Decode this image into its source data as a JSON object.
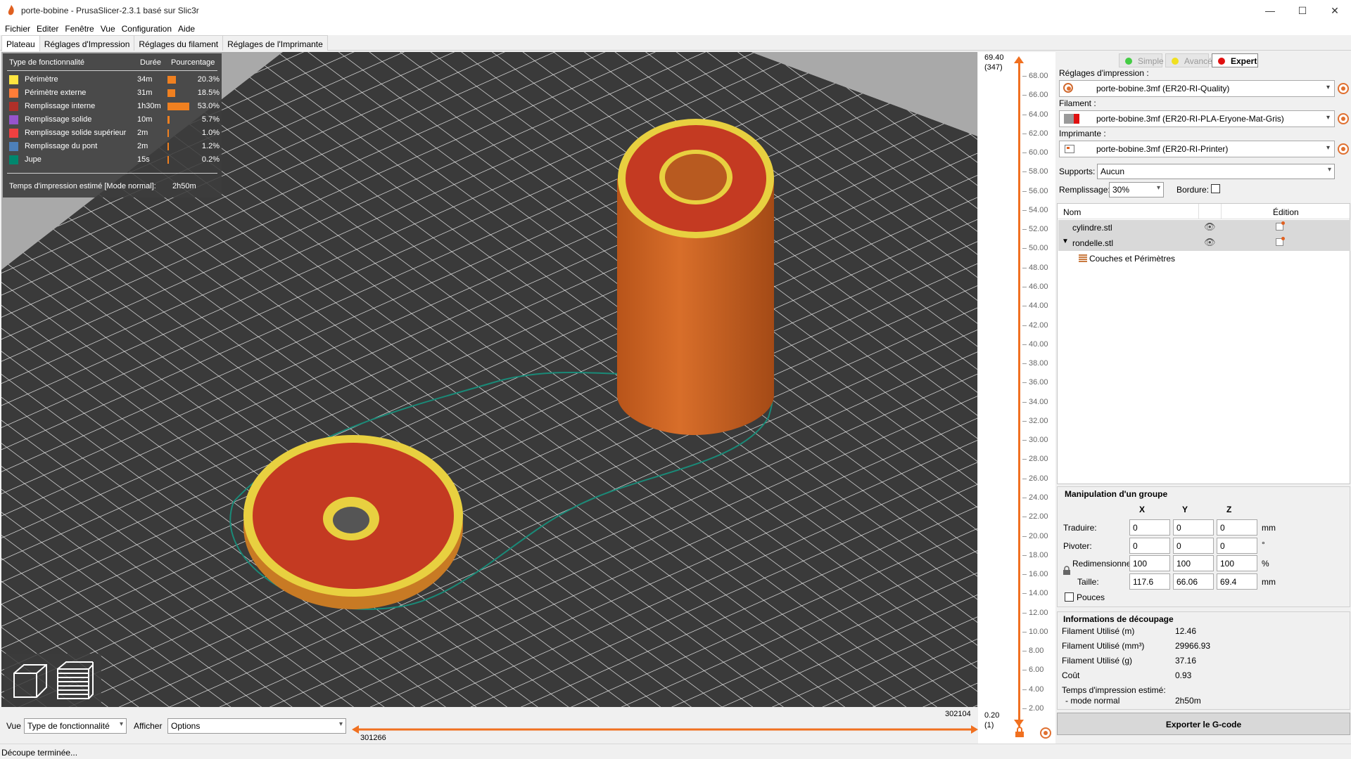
{
  "window": {
    "title": "porte-bobine - PrusaSlicer-2.3.1 basé sur Slic3r",
    "min": "—",
    "max": "☐",
    "close": "✕"
  },
  "menu": [
    "Fichier",
    "Editer",
    "Fenêtre",
    "Vue",
    "Configuration",
    "Aide"
  ],
  "tabs": [
    "Plateau",
    "Réglages d'Impression",
    "Réglages du filament",
    "Réglages de l'Imprimante"
  ],
  "legend": {
    "headers": {
      "type": "Type de fonctionnalité",
      "time": "Durée",
      "pct": "Pourcentage"
    },
    "rows": [
      {
        "name": "Périmètre",
        "time": "34m",
        "pct": "20.3%",
        "value": 20.3,
        "color": "#ffe640"
      },
      {
        "name": "Périmètre externe",
        "time": "31m",
        "pct": "18.5%",
        "value": 18.5,
        "color": "#ff7d38"
      },
      {
        "name": "Remplissage interne",
        "time": "1h30m",
        "pct": "53.0%",
        "value": 53.0,
        "color": "#b03029"
      },
      {
        "name": "Remplissage solide",
        "time": "10m",
        "pct": "5.7%",
        "value": 5.7,
        "color": "#9654cc"
      },
      {
        "name": "Remplissage solide supérieur",
        "time": "2m",
        "pct": "1.0%",
        "value": 1.0,
        "color": "#f04040"
      },
      {
        "name": "Remplissage du pont",
        "time": "2m",
        "pct": "1.2%",
        "value": 1.2,
        "color": "#4d80ba"
      },
      {
        "name": "Jupe",
        "time": "15s",
        "pct": "0.2%",
        "value": 0.2,
        "color": "#00876e"
      }
    ],
    "estimated": "Temps d'impression estimé [Mode normal]:",
    "estimated_value": "2h50m"
  },
  "vslider": {
    "top": "69.40",
    "top_layer": "(347)",
    "bottom": "0.20",
    "bottom_layer": "(1)",
    "ticks": [
      "68.00",
      "66.00",
      "64.00",
      "62.00",
      "60.00",
      "58.00",
      "56.00",
      "54.00",
      "52.00",
      "50.00",
      "48.00",
      "46.00",
      "44.00",
      "42.00",
      "40.00",
      "38.00",
      "36.00",
      "34.00",
      "32.00",
      "30.00",
      "28.00",
      "26.00",
      "24.00",
      "22.00",
      "20.00",
      "18.00",
      "16.00",
      "14.00",
      "12.00",
      "10.00",
      "8.00",
      "6.00",
      "4.00",
      "2.00"
    ]
  },
  "hslider": {
    "left": "301266",
    "right": "302104"
  },
  "bottombar": {
    "vue_label": "Vue",
    "vue_value": "Type de fonctionnalité",
    "afficher_label": "Afficher",
    "afficher_value": "Options"
  },
  "status": "Découpe terminée...",
  "modes": {
    "simple": "Simple",
    "advanced": "Avancé",
    "expert": "Expert",
    "colors": {
      "simple": "#44cc44",
      "advanced": "#f0e020",
      "expert": "#e01010"
    }
  },
  "presets": {
    "print_label": "Réglages d'impression :",
    "print_value": "porte-bobine.3mf (ER20-RI-Quality)",
    "filament_label": "Filament :",
    "filament_value": "porte-bobine.3mf (ER20-RI-PLA-Eryone-Mat-Gris)",
    "printer_label": "Imprimante :",
    "printer_value": "porte-bobine.3mf (ER20-RI-Printer)",
    "supports_label": "Supports:",
    "supports_value": "Aucun",
    "infill_label": "Remplissage:",
    "infill_value": "30%",
    "brim_label": "Bordure:"
  },
  "objects": {
    "col_name": "Nom",
    "col_edit": "Édition",
    "items": [
      "cylindre.stl",
      "rondelle.stl"
    ],
    "sub": "Couches et Périmètres"
  },
  "manip": {
    "title": "Manipulation d'un groupe",
    "x": "X",
    "y": "Y",
    "z": "Z",
    "translate": "Traduire:",
    "rotate": "Pivoter:",
    "scale": "Redimensionner:",
    "size": "Taille:",
    "t": [
      "0",
      "0",
      "0"
    ],
    "r": [
      "0",
      "0",
      "0"
    ],
    "s": [
      "100",
      "100",
      "100"
    ],
    "sz": [
      "117.6",
      "66.06",
      "69.4"
    ],
    "u_mm": "mm",
    "u_deg": "°",
    "u_pct": "%",
    "u_mm2": "mm",
    "inches": "Pouces"
  },
  "info": {
    "title": "Informations de découpage",
    "rows": [
      [
        "Filament Utilisé (m)",
        "12.46"
      ],
      [
        "Filament Utilisé (mm³)",
        "29966.93"
      ],
      [
        "Filament Utilisé (g)",
        "37.16"
      ],
      [
        "Coût",
        "0.93"
      ]
    ],
    "time_label": "Temps d'impression estimé:",
    "time_mode": "- mode normal",
    "time_value": "2h50m"
  },
  "export": "Exporter le G-code"
}
